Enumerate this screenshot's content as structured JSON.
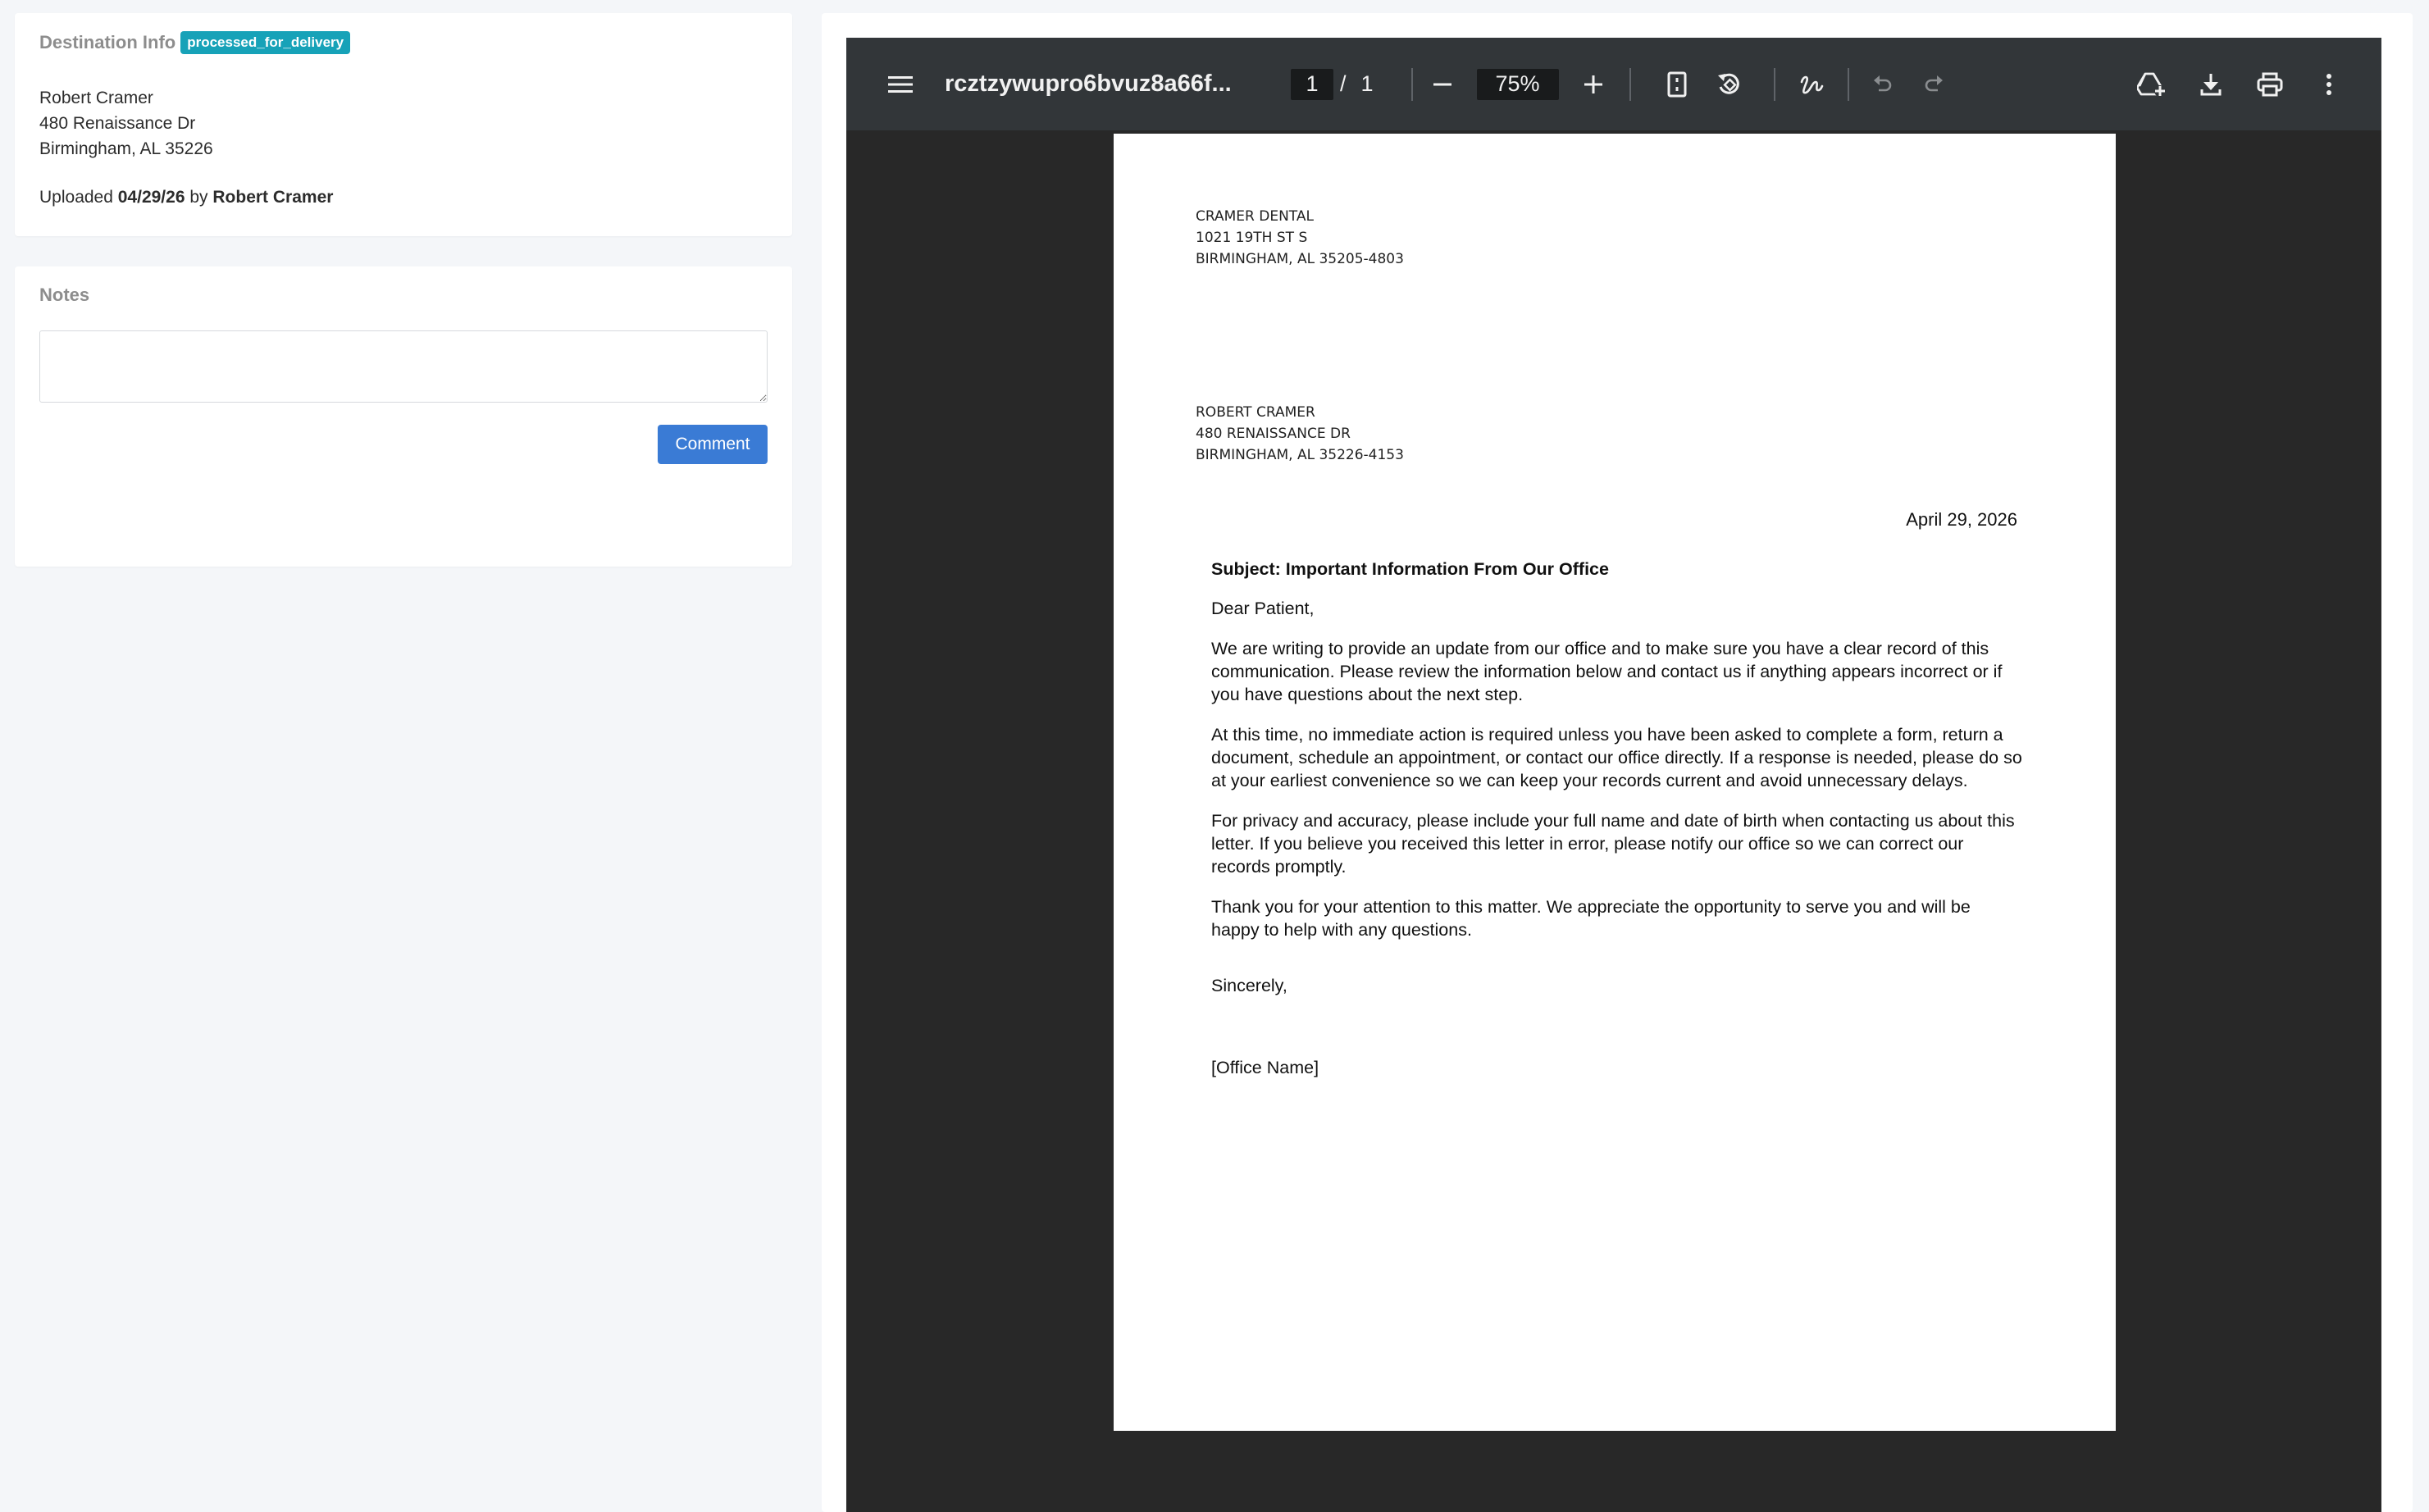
{
  "destination": {
    "title": "Destination Info",
    "status_badge": "processed_for_delivery",
    "address": {
      "name": "Robert Cramer",
      "street": "480 Renaissance Dr",
      "city_state_zip": "Birmingham, AL 35226"
    },
    "uploaded_prefix": "Uploaded",
    "uploaded_date": "04/29/26",
    "uploaded_by_word": "by",
    "uploaded_by": "Robert Cramer"
  },
  "notes": {
    "title": "Notes",
    "textarea_value": "",
    "comment_label": "Comment"
  },
  "viewer": {
    "filename": "rcztzywupro6bvuz8a66f...",
    "current_page": "1",
    "page_separator": "/",
    "total_pages": "1",
    "zoom": "75%",
    "icons": {
      "menu": "menu-icon",
      "zoom_out": "minus-icon",
      "zoom_in": "plus-icon",
      "fit_page": "fit-page-icon",
      "rotate": "rotate-icon",
      "annotate": "draw-icon",
      "undo": "undo-icon",
      "redo": "redo-icon",
      "drive": "add-to-drive-icon",
      "download": "download-icon",
      "print": "print-icon",
      "more": "more-vert-icon"
    }
  },
  "letter": {
    "sender": [
      "CRAMER DENTAL",
      "1021 19TH ST S",
      "BIRMINGHAM, AL 35205-4803"
    ],
    "recipient": [
      "ROBERT CRAMER",
      "480 RENAISSANCE DR",
      "BIRMINGHAM, AL 35226-4153"
    ],
    "date": "April 29, 2026",
    "subject": "Subject: Important Information From Our Office",
    "greeting": "Dear Patient,",
    "paragraphs": [
      "We are writing to provide an update from our office and to make sure you have a clear record of this communication. Please review the information below and contact us if anything appears incorrect or if you have questions about the next step.",
      "At this time, no immediate action is required unless you have been asked to complete a form, return a document, schedule an appointment, or contact our office directly. If a response is needed, please do so at your earliest convenience so we can keep your records current and avoid unnecessary delays.",
      "For privacy and accuracy, please include your full name and date of birth when contacting us about this letter. If you believe you received this letter in error, please notify our office so we can correct our records promptly.",
      "Thank you for your attention to this matter. We appreciate the opportunity to serve you and will be happy to help with any questions."
    ],
    "signoff": "Sincerely,",
    "office_name": "[Office Name]"
  },
  "colors": {
    "badge": "#17a2b8",
    "button": "#3a7bd5",
    "viewer_toolbar": "#323639",
    "viewer_background": "#282828"
  }
}
